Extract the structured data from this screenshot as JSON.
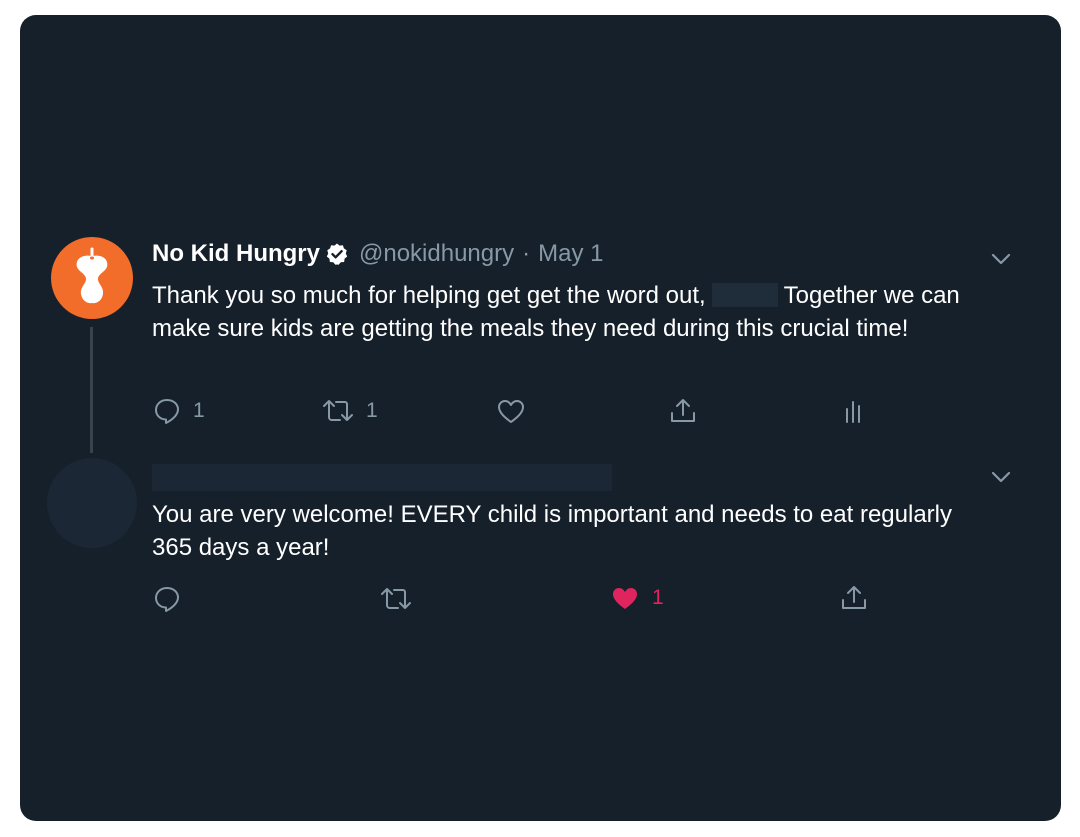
{
  "tweet1": {
    "name": "No Kid Hungry",
    "handle": "@nokidhungry",
    "separator": "·",
    "date": "May 1",
    "text_before": "Thank you so much for helping get get the word out,",
    "text_after": "Together we can make sure kids are getting the meals they need during this crucial time!",
    "reply_count": "1",
    "retweet_count": "1",
    "avatar_color": "#f26c2a"
  },
  "tweet2": {
    "text": "You are very welcome! EVERY child is important and needs to eat regularly 365 days a year!",
    "like_count": "1",
    "liked": true
  },
  "colors": {
    "background": "#15202b",
    "text": "#ffffff",
    "muted": "#8899a6",
    "like": "#e0245e",
    "verified_badge": "#ffffff"
  },
  "icons": [
    "reply-icon",
    "retweet-icon",
    "like-icon",
    "share-icon",
    "analytics-icon",
    "chevron-down-icon",
    "verified-badge-icon",
    "apple-core-logo"
  ]
}
